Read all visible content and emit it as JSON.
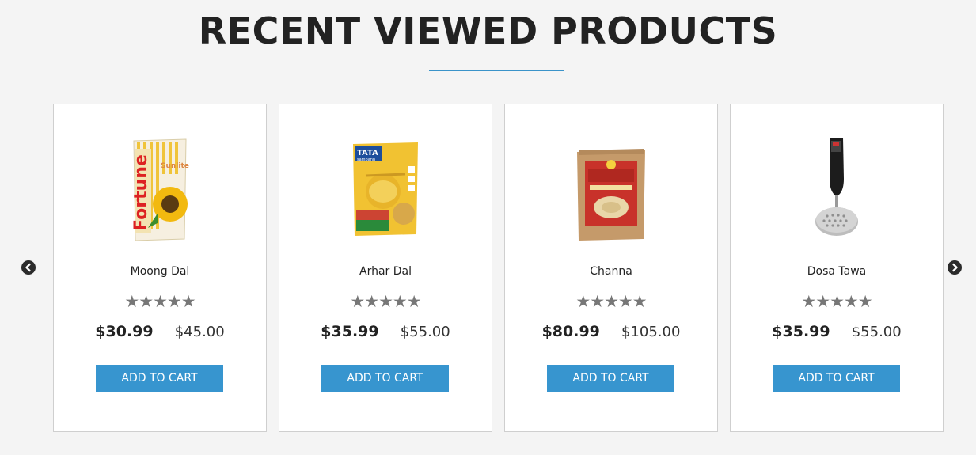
{
  "section": {
    "title": "RECENT VIEWED PRODUCTS"
  },
  "carousel": {
    "prev_icon": "chevron-left-circle",
    "next_icon": "chevron-right-circle"
  },
  "products": [
    {
      "name": "Moong Dal",
      "rating_stars": 5,
      "price": "$30.99",
      "old_price": "$45.00",
      "button_label": "ADD TO CART",
      "image": "fortune-sunlite-oil-pack"
    },
    {
      "name": "Arhar Dal",
      "rating_stars": 5,
      "price": "$35.99",
      "old_price": "$55.00",
      "button_label": "ADD TO CART",
      "image": "tata-sampann-toor-dal-pack",
      "image_text": {
        "brand": "TATA",
        "sub": "sampann"
      }
    },
    {
      "name": "Channa",
      "rating_stars": 5,
      "price": "$80.99",
      "old_price": "$105.00",
      "button_label": "ADD TO CART",
      "image": "aashirvaad-atta-bag"
    },
    {
      "name": "Dosa Tawa",
      "rating_stars": 5,
      "price": "$35.99",
      "old_price": "$55.00",
      "button_label": "ADD TO CART",
      "image": "potato-masher"
    }
  ],
  "colors": {
    "accent": "#3795cf",
    "underline": "#3a93c9",
    "star": "#777777",
    "background": "#f4f4f4"
  }
}
